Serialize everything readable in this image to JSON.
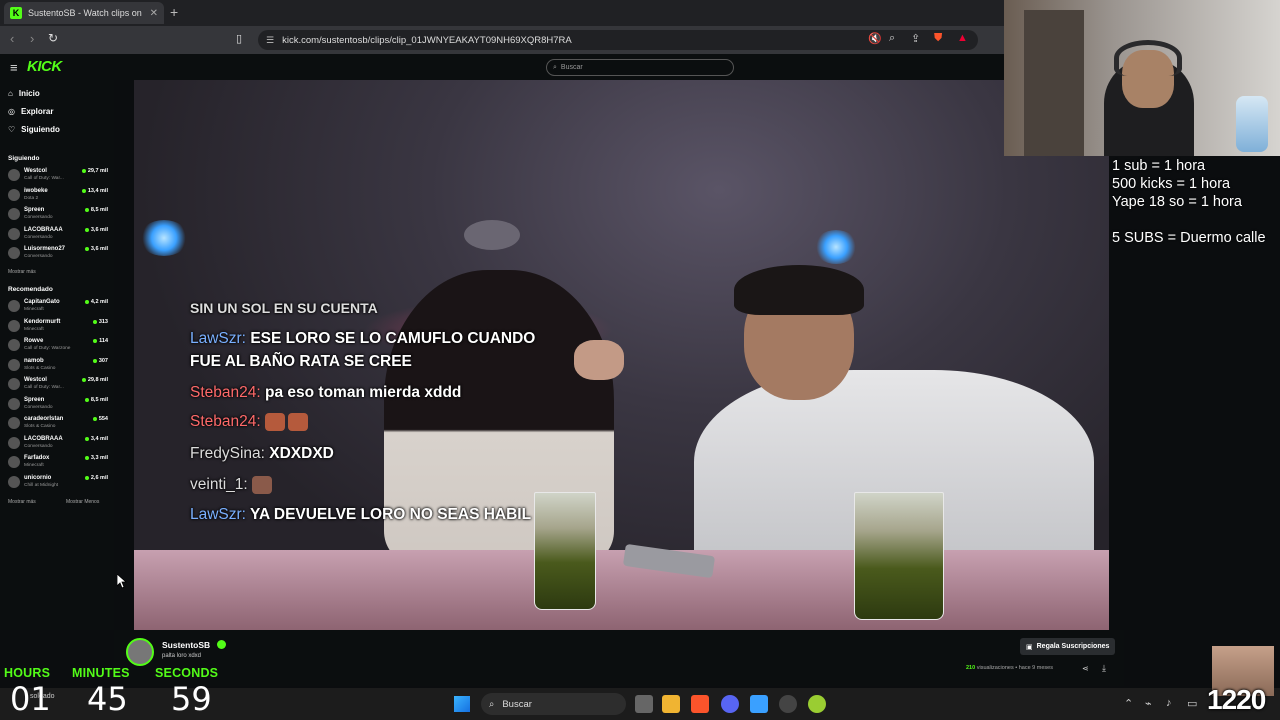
{
  "browser": {
    "tab_title": "SustentoSB - Watch clips on",
    "tab_favicon_letter": "K",
    "new_tab": "+",
    "url": "kick.com/sustentosb/clips/clip_01JWNYEAKAYT09NH69XQR8H7RA"
  },
  "kick": {
    "logo": "KICK",
    "search_placeholder": "Buscar",
    "nav": [
      {
        "label": "Inicio",
        "icon": "home-icon"
      },
      {
        "label": "Explorar",
        "icon": "compass-icon"
      },
      {
        "label": "Siguiendo",
        "icon": "heart-icon"
      }
    ],
    "following_header": "Siguiendo",
    "following": [
      {
        "name": "Westcol",
        "game": "Call of Duty: War...",
        "viewers": "29,7 mil"
      },
      {
        "name": "iwobeke",
        "game": "Dota 2",
        "viewers": "13,4 mil"
      },
      {
        "name": "Spreen",
        "game": "Conversando",
        "viewers": "8,5 mil"
      },
      {
        "name": "LACOBRAAA",
        "game": "Conversando",
        "viewers": "3,6 mil"
      },
      {
        "name": "Luisormeno27",
        "game": "Conversando",
        "viewers": "3,6 mil"
      }
    ],
    "show_more": "Mostrar más",
    "recommended_header": "Recomendado",
    "recommended": [
      {
        "name": "CapitanGato",
        "game": "Minecraft",
        "viewers": "4,2 mil"
      },
      {
        "name": "Kendormurft",
        "game": "Minecraft",
        "viewers": "313"
      },
      {
        "name": "Rowve",
        "game": "Call of Duty: Warzone",
        "viewers": "114"
      },
      {
        "name": "namob",
        "game": "Slots & Casino",
        "viewers": "307"
      },
      {
        "name": "Westcol",
        "game": "Call of Duty: War...",
        "viewers": "29,8 mil"
      },
      {
        "name": "Spreen",
        "game": "Conversando",
        "viewers": "8,5 mil"
      },
      {
        "name": "caradeorlstan",
        "game": "Slots & Casino",
        "viewers": "554"
      },
      {
        "name": "LACOBRAAA",
        "game": "Conversando",
        "viewers": "3,4 mil"
      },
      {
        "name": "Farfadox",
        "game": "Minecraft",
        "viewers": "3,3 mil"
      },
      {
        "name": "unicornio",
        "game": "Chill at Midnight",
        "viewers": "2,6 mil"
      }
    ],
    "show_more_2": "Mostrar más",
    "show_less": "Mostrar Menos"
  },
  "chat": [
    {
      "user": "",
      "text": "SIN UN SOL EN SU CUENTA"
    },
    {
      "user": "LawSzr:",
      "text": "ESE LORO SE LO CAMUFLO CUANDO"
    },
    {
      "user": "",
      "text": "FUE AL BAÑO RATA SE CREE"
    },
    {
      "user": "Steban24:",
      "text": "pa eso toman mierda xddd"
    },
    {
      "user": "Steban24:",
      "text": ""
    },
    {
      "user": "FredySina:",
      "text": "XDXDXD"
    },
    {
      "user": "veinti_1:",
      "text": ""
    },
    {
      "user": "LawSzr:",
      "text": "YA DEVUELVE LORO NO SEAS HABIL"
    }
  ],
  "overlay_rules": [
    "1 sub = 1 hora",
    "500 kicks = 1 hora",
    "Yape 18 so = 1 hora",
    "",
    "5 SUBS = Duermo calle"
  ],
  "clip": {
    "channel": "SustentoSB",
    "title": "palta loro xdxd",
    "gift_button": "Regala Suscripciones",
    "views": "210",
    "views_label": "visualizaciones",
    "ago": "• hace 9 meses"
  },
  "timer": {
    "hours_label": "HOURS",
    "minutes_label": "MINUTES",
    "seconds_label": "SECONDS",
    "hours": "01",
    "minutes": "45",
    "seconds": "59"
  },
  "taskbar": {
    "search": "Buscar",
    "weather": "soleado"
  },
  "counter": "1220",
  "colors": {
    "kick_green": "#53fc18",
    "chat_blue": "#7ab0ff",
    "chat_red": "#ff6a6a"
  }
}
